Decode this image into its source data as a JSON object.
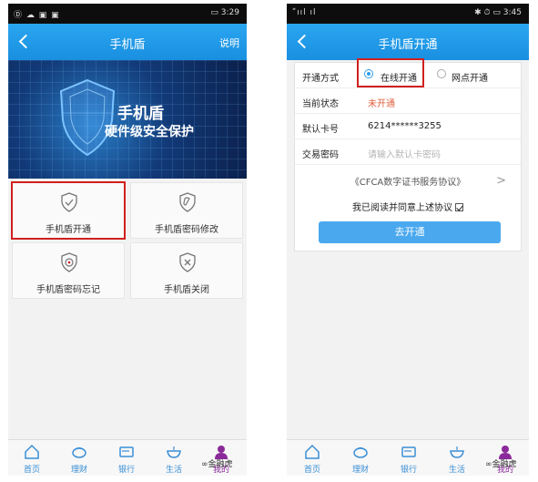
{
  "left_screen": {
    "status_time": "3:29",
    "status_icons_left": "Ⓓ ☁ ▣ ▣",
    "status_icons_right": "▭",
    "nav_title": "手机盾",
    "nav_right": "说明",
    "banner_title": "手机盾",
    "banner_subtitle": "硬件级安全保护",
    "tiles": [
      {
        "label": "手机盾开通",
        "icon": "shield-check-icon"
      },
      {
        "label": "手机盾密码修改",
        "icon": "shield-wrench-icon"
      },
      {
        "label": "手机盾密码忘记",
        "icon": "shield-target-icon"
      },
      {
        "label": "手机盾关闭",
        "icon": "shield-x-icon"
      }
    ]
  },
  "right_screen": {
    "status_time": "3:45",
    "status_icons_left": "ʺııl ıl",
    "status_icons_right": "✱ ⏱ ▭",
    "nav_title": "手机盾开通",
    "form": {
      "method_label": "开通方式",
      "method_online": "在线开通",
      "method_branch": "网点开通",
      "status_label": "当前状态",
      "status_value": "未开通",
      "card_label": "默认卡号",
      "card_value": "6214******3255",
      "pwd_label": "交易密码",
      "pwd_placeholder": "请输入默认卡密码",
      "agreement": "《CFCA数字证书服务协议》",
      "agreement_arrow": ">",
      "consent": "我已阅读并同意上述协议",
      "submit": "去开通"
    }
  },
  "tabbar": [
    {
      "label": "首页",
      "icon": "home-icon"
    },
    {
      "label": "理财",
      "icon": "piggy-bank-icon"
    },
    {
      "label": "银行",
      "icon": "card-icon"
    },
    {
      "label": "生活",
      "icon": "bowl-icon"
    },
    {
      "label": "我的",
      "icon": "user-icon"
    }
  ],
  "watermark": "∞金融虎",
  "colors": {
    "nav_blue": "#1a8fe0",
    "highlight_red": "#d0201e",
    "tab_blue": "#3a8fd6",
    "mine_purple": "#8b2a9a"
  }
}
